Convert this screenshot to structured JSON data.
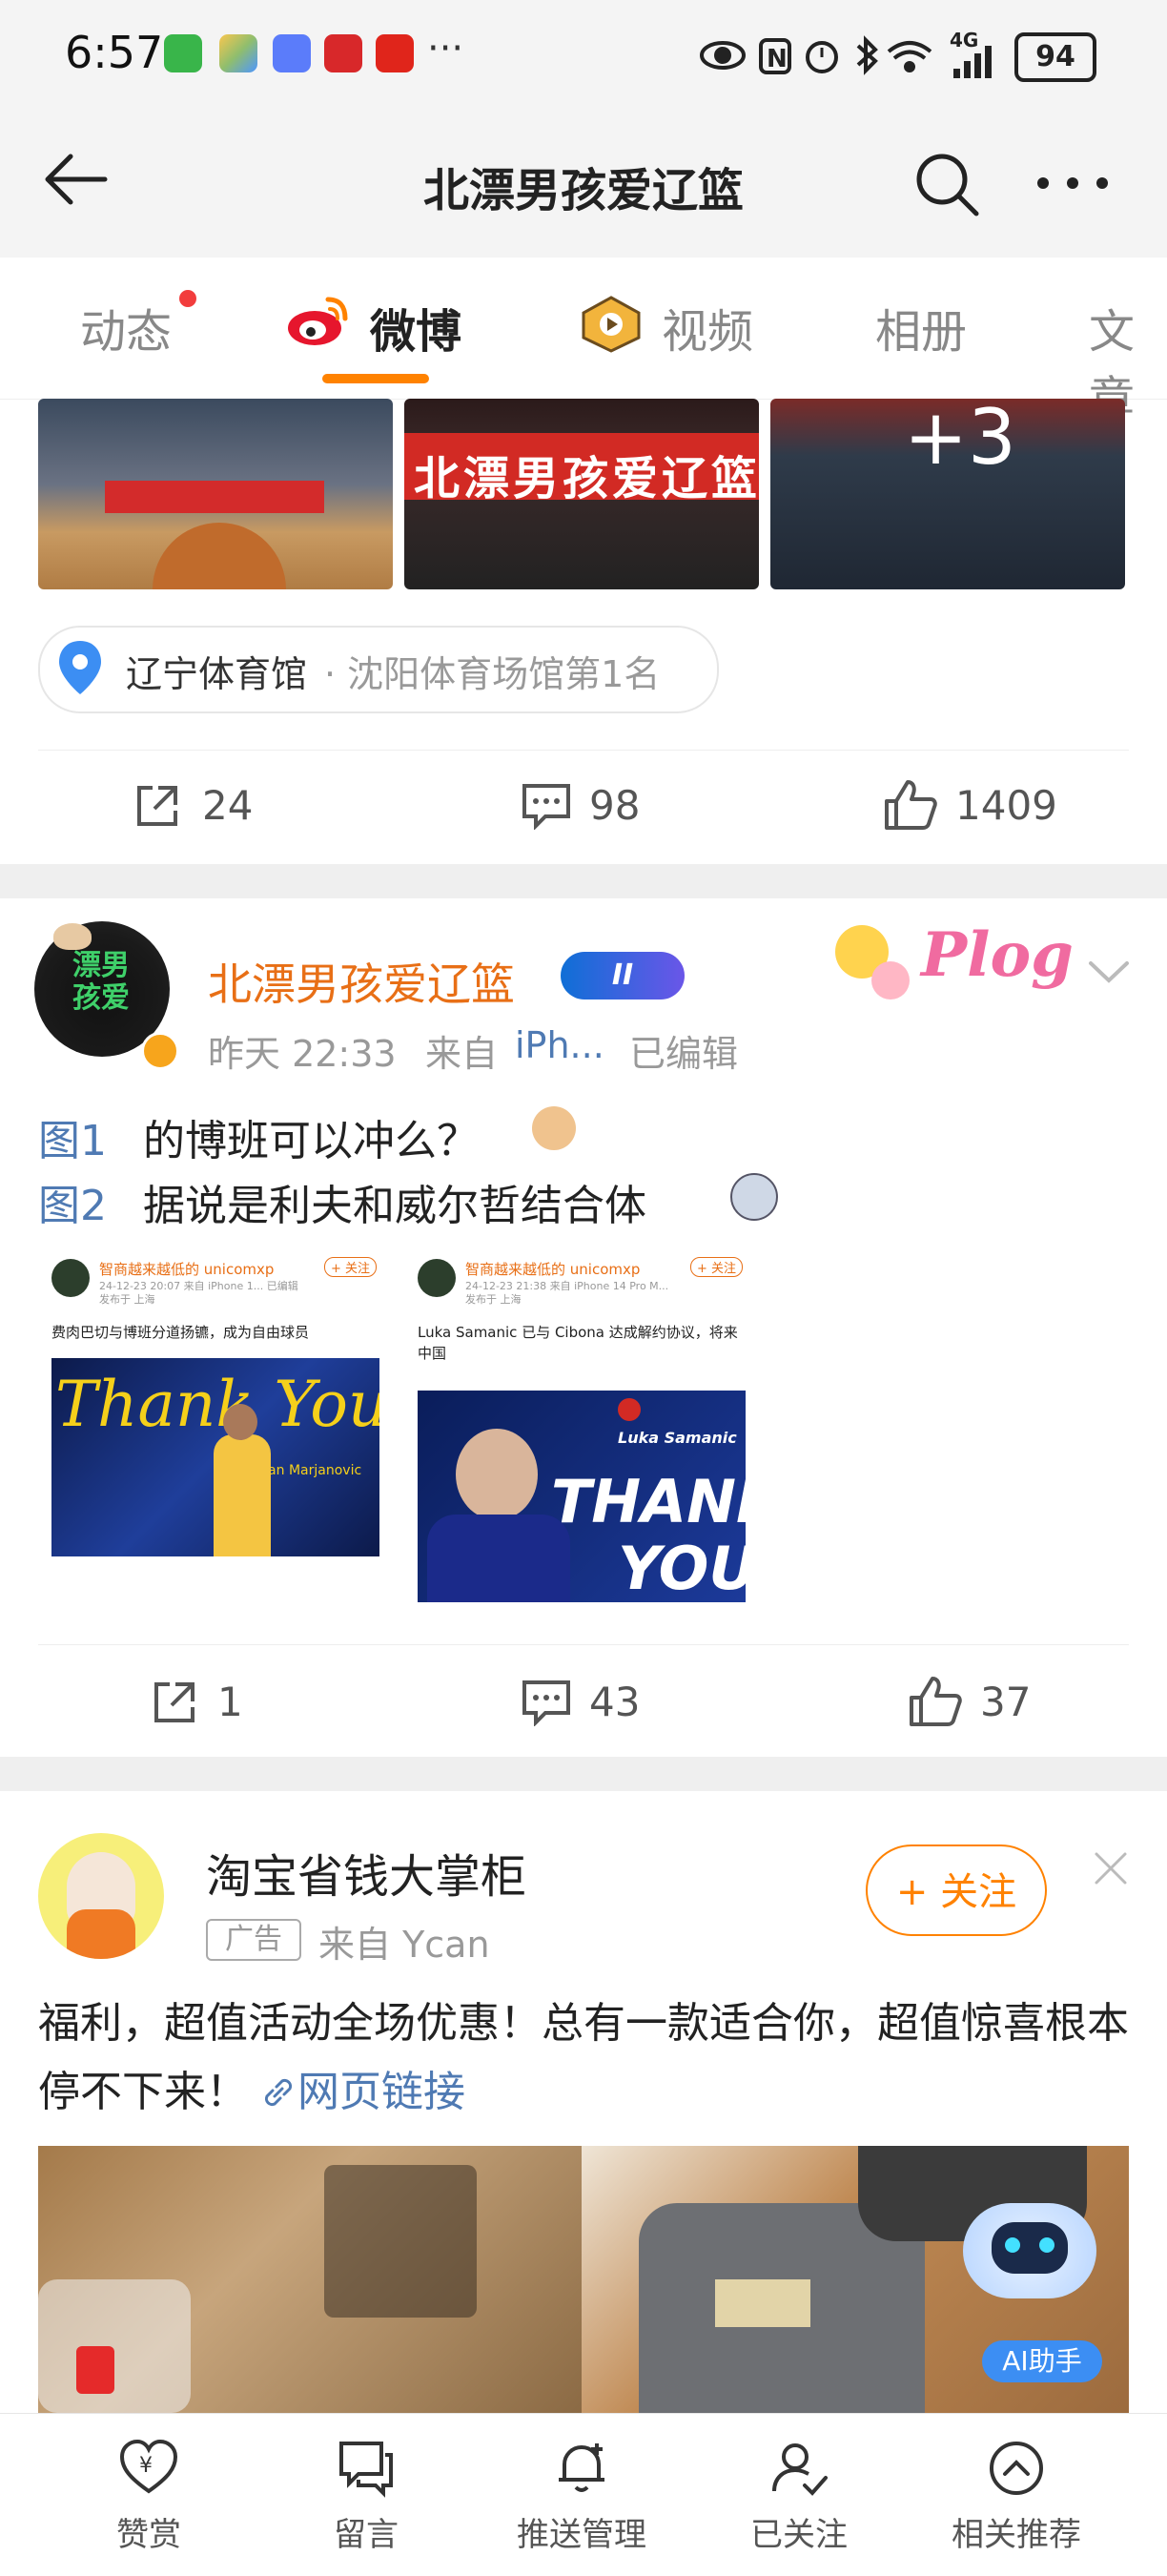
{
  "status_bar": {
    "time": "6:57",
    "more": "···",
    "network": "4G",
    "battery": "94"
  },
  "header": {
    "title": "北漂男孩爱辽篮"
  },
  "tabs": [
    {
      "label": "动态"
    },
    {
      "label": "微博"
    },
    {
      "label": "视频"
    },
    {
      "label": "相册"
    },
    {
      "label": "文章"
    }
  ],
  "post1": {
    "more_count": "+3",
    "banner_text": "北漂男孩爱辽篮",
    "location_name": "辽宁体育馆",
    "location_detail": "· 沈阳体育场馆第1名",
    "reposts": "24",
    "comments": "98",
    "likes": "1409"
  },
  "post2": {
    "author": "北漂男孩爱辽篮",
    "level_badge": "II",
    "time": "昨天 22:33",
    "source": "来自",
    "device": "iPh...",
    "edited": "已编辑",
    "line1_ref": "图1",
    "line1_text": "的博班可以冲么？",
    "line2_ref": "图2",
    "line2_text": "据说是利夫和威尔哲结合体",
    "sticker": "Plog",
    "img1": {
      "author": "智商越来越低的 unicomxp",
      "meta": "24-12-23 20:07 来自 iPhone 1... 已编辑",
      "ip": "发布于 上海",
      "follow": "+ 关注",
      "text": "费肉巴切与博班分道扬镳，成为自由球员",
      "thank": "Thank You",
      "player": "Boban Marjanovic"
    },
    "img2": {
      "author": "智商越来越低的 unicomxp",
      "meta": "24-12-23 21:38 来自 iPhone 14 Pro M...",
      "ip": "发布于 上海",
      "follow": "+ 关注",
      "text": "Luka Samanic 已与 Cibona 达成解约协议，将来中国",
      "player": "Luka Samanic",
      "thank1": "THANK",
      "thank2": "YOU"
    },
    "reposts": "1",
    "comments": "43",
    "likes": "37"
  },
  "post3": {
    "author": "淘宝省钱大掌柜",
    "ad_tag": "广告",
    "source": "来自 Ycan",
    "follow": "+ 关注",
    "text": "福利，超值活动全场优惠！总有一款适合你，超值惊喜根本停不下来！",
    "link": "网页链接",
    "ai_badge": "AI助手"
  },
  "bottom_bar": [
    {
      "label": "赞赏",
      "icon": "reward-icon"
    },
    {
      "label": "留言",
      "icon": "message-icon"
    },
    {
      "label": "推送管理",
      "icon": "bell-icon"
    },
    {
      "label": "已关注",
      "icon": "followed-icon"
    },
    {
      "label": "相关推荐",
      "icon": "recommend-icon"
    }
  ],
  "colors": {
    "accent": "#ff8200",
    "author_name": "#e86f16",
    "link": "#4f7ab3"
  }
}
